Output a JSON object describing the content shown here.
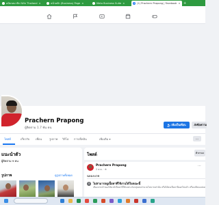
{
  "browser": {
    "tabs": [
      {
        "title": "สมัครสมาชิก iWin Thailand",
        "active": false
      },
      {
        "title": "หน้าหลัก (Business) Page",
        "active": false
      },
      {
        "title": "Meta Business Suite",
        "active": false
      },
      {
        "title": "(1) Prachern Prapong | Facebook",
        "active": true
      }
    ],
    "new_tab_label": "+",
    "tab_close_glyph": "×"
  },
  "fb_nav": {
    "icons": [
      "home-icon",
      "flag-icon",
      "video-icon",
      "marketplace-icon",
      "gaming-icon"
    ]
  },
  "profile": {
    "name": "Prachern Prapong",
    "followers": "ผู้ติดตาม 1.7 พัน คน",
    "add_friend_label": "เพิ่มเป็นเพื่อน",
    "message_label": "ส่งข้อความ"
  },
  "profile_tabs": {
    "items": [
      "โพสต์",
      "เกี่ยวกับ",
      "เพื่อน",
      "รูปภาพ",
      "วิดีโอ",
      "การเช็คอิน",
      "เพิ่มเติม ▾"
    ],
    "more_glyph": "···"
  },
  "intro": {
    "title": "แนะนำตัว",
    "text": "ผู้ติดตาม 9 คน"
  },
  "photos": {
    "title": "รูปภาพ",
    "link": "ดูรูปภาพทั้งหมด"
  },
  "posts": {
    "title": "โพสต์",
    "filter_label": "ตัวกรอง",
    "post": {
      "author": "Prachern Prapong",
      "time": "2 ส.ค. · ⊕",
      "text": "ฉลองบวช",
      "more_glyph": "···"
    },
    "notice": {
      "icon": "i",
      "title": "ไม่สามารถดูเนื้อหาที่ใช้งานได้ในขณะนี้",
      "body": "เนื่องจากเจ้าของได้แชร์เนื้อหานี้ให้เฉพาะกับกลุ่มคนจำนวนไม่มากเท่านั้น หรือได้ลบเนื้อหานี้ออกไปแล้ว หรือเปลี่ยนแปลงการตั้งค่าว่าใครสามารถดูเนื้อหานี้ได้"
    }
  },
  "colors": {
    "tab_strip": "#2e9a40",
    "fb_blue": "#1877f2",
    "background": "#f0f2f5"
  }
}
